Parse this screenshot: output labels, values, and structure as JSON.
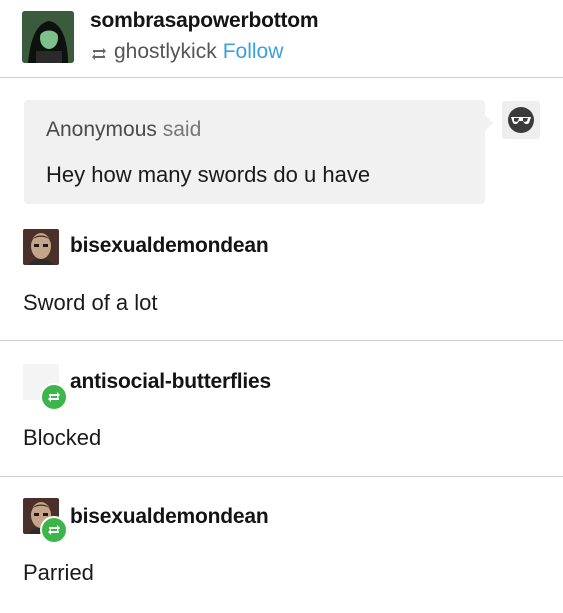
{
  "post": {
    "author": "sombrasapowerbottom",
    "reblogged_from": "ghostlykick",
    "follow_label": "Follow"
  },
  "ask": {
    "asker": "Anonymous",
    "said": "said",
    "question": "Hey how many swords do u have"
  },
  "thread": [
    {
      "user": "bisexualdemondean",
      "text": "Sword of a lot"
    },
    {
      "user": "antisocial-butterflies",
      "text": "Blocked"
    },
    {
      "user": "bisexualdemondean",
      "text": "Parried"
    }
  ],
  "colors": {
    "follow": "#3aa0e0",
    "reblog_badge": "#3cb64a",
    "ask_bg": "#f1f1f1",
    "divider": "#cfcfcf"
  },
  "icons": [
    "reblog-icon",
    "reblog-badge-icon",
    "sunglasses-icon"
  ]
}
